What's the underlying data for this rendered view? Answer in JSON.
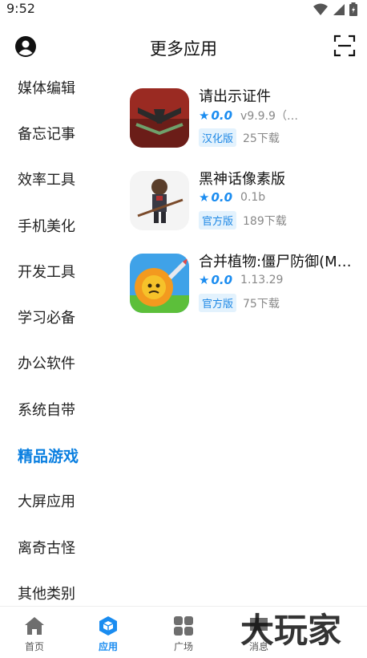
{
  "status": {
    "time": "9:52"
  },
  "header": {
    "title": "更多应用"
  },
  "sidebar": {
    "items": [
      {
        "label": "媒体编辑",
        "active": false
      },
      {
        "label": "备忘记事",
        "active": false
      },
      {
        "label": "效率工具",
        "active": false
      },
      {
        "label": "手机美化",
        "active": false
      },
      {
        "label": "开发工具",
        "active": false
      },
      {
        "label": "学习必备",
        "active": false
      },
      {
        "label": "办公软件",
        "active": false
      },
      {
        "label": "系统自带",
        "active": false
      },
      {
        "label": "精品游戏",
        "active": true
      },
      {
        "label": "大屏应用",
        "active": false
      },
      {
        "label": "离奇古怪",
        "active": false
      },
      {
        "label": "其他类别",
        "active": false
      }
    ]
  },
  "apps": [
    {
      "name": "请出示证件",
      "rating": "0.0",
      "version": "v9.9.9（…",
      "badge": "汉化版",
      "downloads": "25下载"
    },
    {
      "name": "黑神话像素版",
      "rating": "0.0",
      "version": "0.1b",
      "badge": "官方版",
      "downloads": "189下载"
    },
    {
      "name": "合并植物:僵尸防御(M…",
      "rating": "0.0",
      "version": "1.13.29",
      "badge": "官方版",
      "downloads": "75下载"
    }
  ],
  "bottom_nav": {
    "items": [
      {
        "label": "首页",
        "icon": "home-icon",
        "active": false
      },
      {
        "label": "应用",
        "icon": "apps-cube-icon",
        "active": true
      },
      {
        "label": "广场",
        "icon": "grid-icon",
        "active": false
      },
      {
        "label": "消息",
        "icon": "message-icon",
        "active": false
      }
    ]
  },
  "watermark": {
    "text": "大玩家"
  },
  "colors": {
    "accent": "#1a8cf0",
    "active_bg": "#bfe0fb",
    "badge_bg": "#e3f2fd"
  }
}
